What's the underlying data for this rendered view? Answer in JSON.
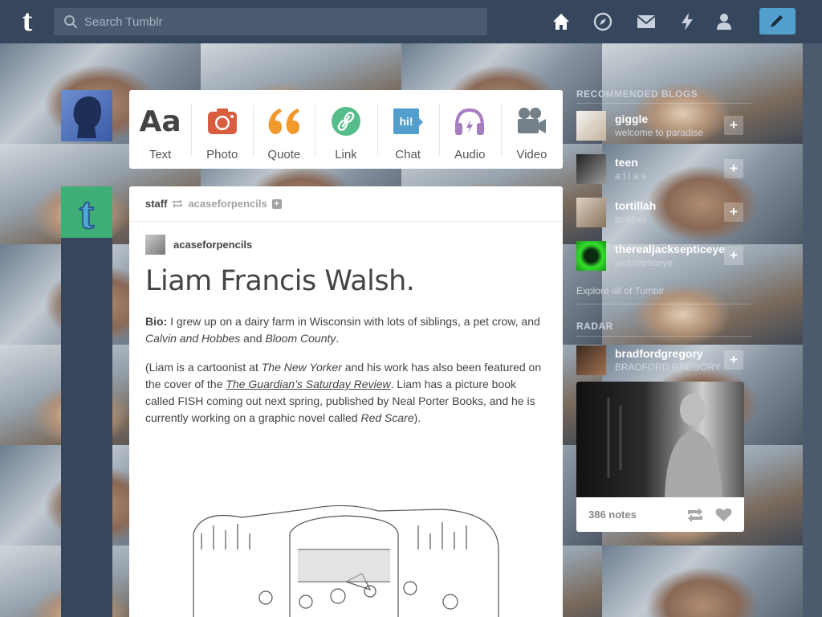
{
  "header": {
    "logo": "t",
    "search_placeholder": "Search Tumblr",
    "nav_icons": [
      "home-icon",
      "explore-icon",
      "inbox-icon",
      "activity-icon",
      "account-icon"
    ],
    "compose_icon": "pencil-icon"
  },
  "colors": {
    "navy": "#36465d",
    "compose": "#529ecc",
    "text_red": "#d95e40",
    "quote_orange": "#f2992e",
    "link_green": "#56bc8a",
    "chat_blue": "#529ecc",
    "audio_purple": "#a77dc2",
    "video_gray": "#748089"
  },
  "post_types": [
    {
      "label": "Text",
      "icon": "text-icon"
    },
    {
      "label": "Photo",
      "icon": "camera-icon"
    },
    {
      "label": "Quote",
      "icon": "quote-icon"
    },
    {
      "label": "Link",
      "icon": "link-icon"
    },
    {
      "label": "Chat",
      "icon": "chat-icon"
    },
    {
      "label": "Audio",
      "icon": "headphones-icon"
    },
    {
      "label": "Video",
      "icon": "video-camera-icon"
    }
  ],
  "post": {
    "reblogger": "staff",
    "reblogged_from": "acaseforpencils",
    "source_blog": "acaseforpencils",
    "title": "Liam Francis Walsh.",
    "bio_label": "Bio:",
    "bio_1": " I grew up on a dairy farm in Wisconsin with lots of siblings, a pet crow, and ",
    "bio_em1": "Calvin and Hobbes",
    "bio_2": " and ",
    "bio_em2": "Bloom County",
    "bio_3": ".",
    "p2_1": "(Liam is a cartoonist at ",
    "p2_em1": "The New Yorker",
    "p2_2": " and his work has also been featured on the cover of the ",
    "p2_em2": "The Guardian’s Saturday Review",
    "p2_3": ". Liam has a picture book called FISH coming out next spring, published by Neal Porter Books, and he is currently working on a graphic novel called ",
    "p2_em3": "Red Scare",
    "p2_4": ")."
  },
  "sidebar": {
    "recommended_title": "Recommended Blogs",
    "blogs": [
      {
        "name": "giggle",
        "sub": "welcome to paradise"
      },
      {
        "name": "teen",
        "sub": "a t l a s"
      },
      {
        "name": "tortillah",
        "sub": "tortillah"
      },
      {
        "name": "therealjacksepticeye",
        "sub": "jacksepticeye"
      }
    ],
    "explore": "Explore all of Tumblr",
    "radar_title": "Radar",
    "radar_blog": {
      "name": "bradfordgregory",
      "sub": "BRADFORD GREGORY"
    },
    "radar_notes": "386 notes"
  }
}
